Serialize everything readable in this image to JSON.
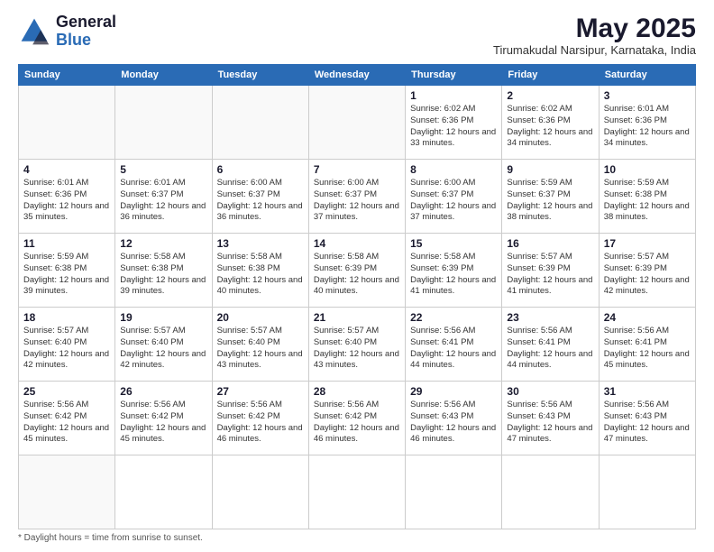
{
  "header": {
    "logo_line1": "General",
    "logo_line2": "Blue",
    "month_year": "May 2025",
    "location": "Tirumakudal Narsipur, Karnataka, India"
  },
  "weekdays": [
    "Sunday",
    "Monday",
    "Tuesday",
    "Wednesday",
    "Thursday",
    "Friday",
    "Saturday"
  ],
  "footer": {
    "note": "Daylight hours"
  },
  "days": [
    {
      "date": "",
      "sunrise": "",
      "sunset": "",
      "daylight": ""
    },
    {
      "date": "",
      "sunrise": "",
      "sunset": "",
      "daylight": ""
    },
    {
      "date": "",
      "sunrise": "",
      "sunset": "",
      "daylight": ""
    },
    {
      "date": "",
      "sunrise": "",
      "sunset": "",
      "daylight": ""
    },
    {
      "date": "1",
      "sunrise": "6:02 AM",
      "sunset": "6:36 PM",
      "daylight": "12 hours and 33 minutes."
    },
    {
      "date": "2",
      "sunrise": "6:02 AM",
      "sunset": "6:36 PM",
      "daylight": "12 hours and 34 minutes."
    },
    {
      "date": "3",
      "sunrise": "6:01 AM",
      "sunset": "6:36 PM",
      "daylight": "12 hours and 34 minutes."
    },
    {
      "date": "4",
      "sunrise": "6:01 AM",
      "sunset": "6:36 PM",
      "daylight": "12 hours and 35 minutes."
    },
    {
      "date": "5",
      "sunrise": "6:01 AM",
      "sunset": "6:37 PM",
      "daylight": "12 hours and 36 minutes."
    },
    {
      "date": "6",
      "sunrise": "6:00 AM",
      "sunset": "6:37 PM",
      "daylight": "12 hours and 36 minutes."
    },
    {
      "date": "7",
      "sunrise": "6:00 AM",
      "sunset": "6:37 PM",
      "daylight": "12 hours and 37 minutes."
    },
    {
      "date": "8",
      "sunrise": "6:00 AM",
      "sunset": "6:37 PM",
      "daylight": "12 hours and 37 minutes."
    },
    {
      "date": "9",
      "sunrise": "5:59 AM",
      "sunset": "6:37 PM",
      "daylight": "12 hours and 38 minutes."
    },
    {
      "date": "10",
      "sunrise": "5:59 AM",
      "sunset": "6:38 PM",
      "daylight": "12 hours and 38 minutes."
    },
    {
      "date": "11",
      "sunrise": "5:59 AM",
      "sunset": "6:38 PM",
      "daylight": "12 hours and 39 minutes."
    },
    {
      "date": "12",
      "sunrise": "5:58 AM",
      "sunset": "6:38 PM",
      "daylight": "12 hours and 39 minutes."
    },
    {
      "date": "13",
      "sunrise": "5:58 AM",
      "sunset": "6:38 PM",
      "daylight": "12 hours and 40 minutes."
    },
    {
      "date": "14",
      "sunrise": "5:58 AM",
      "sunset": "6:39 PM",
      "daylight": "12 hours and 40 minutes."
    },
    {
      "date": "15",
      "sunrise": "5:58 AM",
      "sunset": "6:39 PM",
      "daylight": "12 hours and 41 minutes."
    },
    {
      "date": "16",
      "sunrise": "5:57 AM",
      "sunset": "6:39 PM",
      "daylight": "12 hours and 41 minutes."
    },
    {
      "date": "17",
      "sunrise": "5:57 AM",
      "sunset": "6:39 PM",
      "daylight": "12 hours and 42 minutes."
    },
    {
      "date": "18",
      "sunrise": "5:57 AM",
      "sunset": "6:40 PM",
      "daylight": "12 hours and 42 minutes."
    },
    {
      "date": "19",
      "sunrise": "5:57 AM",
      "sunset": "6:40 PM",
      "daylight": "12 hours and 42 minutes."
    },
    {
      "date": "20",
      "sunrise": "5:57 AM",
      "sunset": "6:40 PM",
      "daylight": "12 hours and 43 minutes."
    },
    {
      "date": "21",
      "sunrise": "5:57 AM",
      "sunset": "6:40 PM",
      "daylight": "12 hours and 43 minutes."
    },
    {
      "date": "22",
      "sunrise": "5:56 AM",
      "sunset": "6:41 PM",
      "daylight": "12 hours and 44 minutes."
    },
    {
      "date": "23",
      "sunrise": "5:56 AM",
      "sunset": "6:41 PM",
      "daylight": "12 hours and 44 minutes."
    },
    {
      "date": "24",
      "sunrise": "5:56 AM",
      "sunset": "6:41 PM",
      "daylight": "12 hours and 45 minutes."
    },
    {
      "date": "25",
      "sunrise": "5:56 AM",
      "sunset": "6:42 PM",
      "daylight": "12 hours and 45 minutes."
    },
    {
      "date": "26",
      "sunrise": "5:56 AM",
      "sunset": "6:42 PM",
      "daylight": "12 hours and 45 minutes."
    },
    {
      "date": "27",
      "sunrise": "5:56 AM",
      "sunset": "6:42 PM",
      "daylight": "12 hours and 46 minutes."
    },
    {
      "date": "28",
      "sunrise": "5:56 AM",
      "sunset": "6:42 PM",
      "daylight": "12 hours and 46 minutes."
    },
    {
      "date": "29",
      "sunrise": "5:56 AM",
      "sunset": "6:43 PM",
      "daylight": "12 hours and 46 minutes."
    },
    {
      "date": "30",
      "sunrise": "5:56 AM",
      "sunset": "6:43 PM",
      "daylight": "12 hours and 47 minutes."
    },
    {
      "date": "31",
      "sunrise": "5:56 AM",
      "sunset": "6:43 PM",
      "daylight": "12 hours and 47 minutes."
    },
    {
      "date": "",
      "sunrise": "",
      "sunset": "",
      "daylight": ""
    }
  ]
}
